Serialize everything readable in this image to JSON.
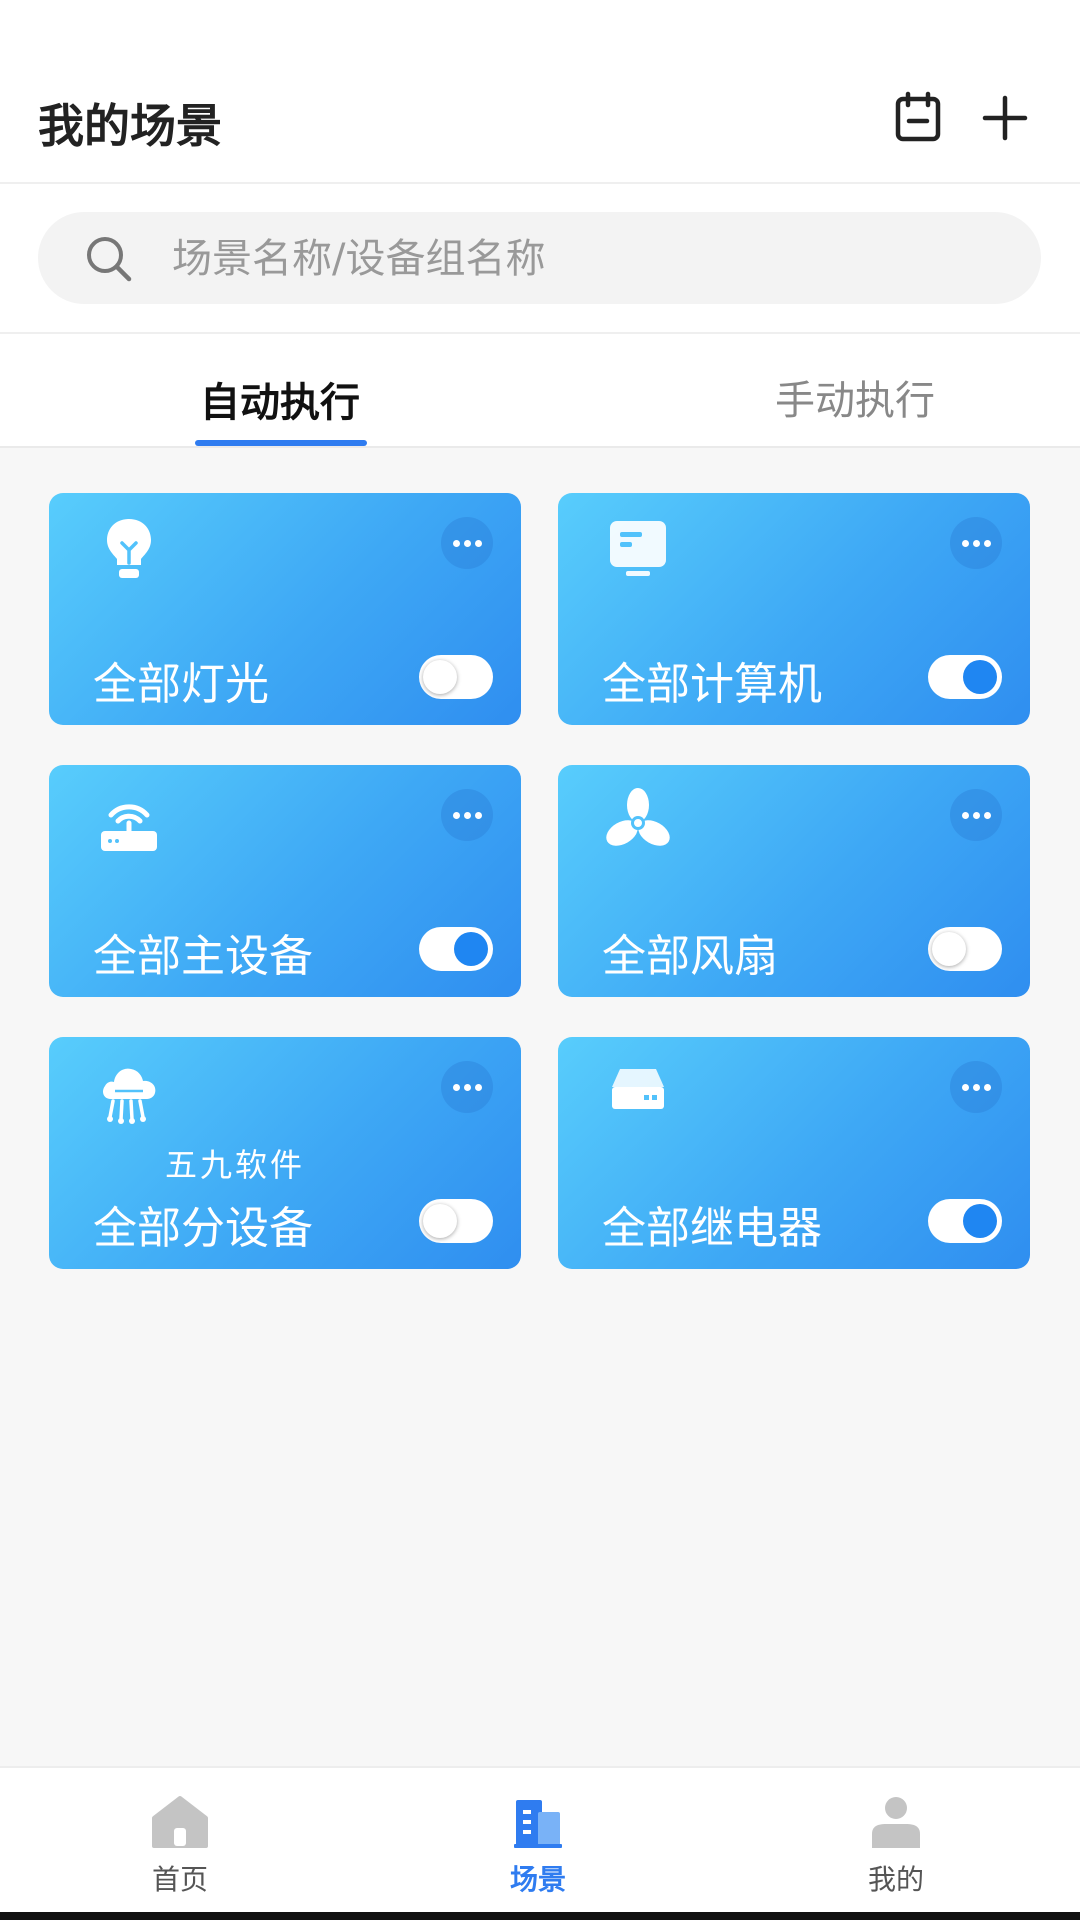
{
  "header": {
    "title": "我的场景",
    "icons": [
      "calendar-icon",
      "add-icon"
    ]
  },
  "search": {
    "placeholder": "场景名称/设备组名称",
    "value": ""
  },
  "tabs": [
    {
      "label": "自动执行",
      "active": true
    },
    {
      "label": "手动执行",
      "active": false
    }
  ],
  "accent_color": "#2f7cf0",
  "cards": [
    {
      "label": "全部灯光",
      "icon": "lightbulb-icon",
      "enabled": false
    },
    {
      "label": "全部计算机",
      "icon": "monitor-icon",
      "enabled": true
    },
    {
      "label": "全部主设备",
      "icon": "router-icon",
      "enabled": true
    },
    {
      "label": "全部风扇",
      "icon": "fan-icon",
      "enabled": false
    },
    {
      "label": "全部分设备",
      "icon": "cloud-device-icon",
      "enabled": false
    },
    {
      "label": "全部继电器",
      "icon": "relay-icon",
      "enabled": true
    }
  ],
  "watermark": "五九软件",
  "bottom_nav": [
    {
      "label": "首页",
      "icon": "home-icon",
      "active": false
    },
    {
      "label": "场景",
      "icon": "building-icon",
      "active": true
    },
    {
      "label": "我的",
      "icon": "user-icon",
      "active": false
    }
  ]
}
